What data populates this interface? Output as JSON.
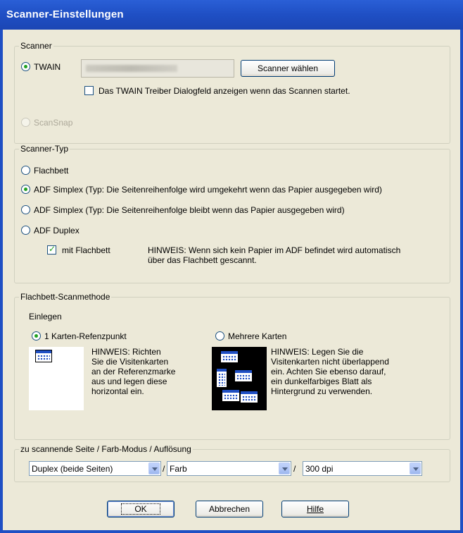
{
  "window": {
    "title": "Scanner-Einstellungen"
  },
  "scanner": {
    "legend": "Scanner",
    "twain_label": "TWAIN",
    "select_button": "Scanner wählen",
    "show_dialog_label": "Das TWAIN Treiber Dialogfeld anzeigen wenn das Scannen startet.",
    "show_dialog_checked": false,
    "scansnap_label": "ScanSnap",
    "selected": "TWAIN"
  },
  "scanner_type": {
    "legend": "Scanner-Typ",
    "options": [
      {
        "label": "Flachbett",
        "selected": false
      },
      {
        "label": "ADF Simplex (Typ: Die Seitenreihenfolge wird umgekehrt wenn das Papier ausgegeben wird)",
        "selected": true
      },
      {
        "label": "ADF Simplex (Typ: Die Seitenreihenfolge bleibt wenn das Papier ausgegeben wird)",
        "selected": false
      },
      {
        "label": "ADF Duplex",
        "selected": false
      }
    ],
    "with_flatbed_label": "mit Flachbett",
    "with_flatbed_checked": true,
    "note_line1": "HINWEIS: Wenn sich kein Papier im ADF befindet wird automatisch",
    "note_line2": "über das Flachbett gescannt."
  },
  "flatbed_method": {
    "legend": "Flachbett-Scanmethode",
    "insert_label": "Einlegen",
    "single_label": "1 Karten-Refenzpunkt",
    "multi_label": "Mehrere Karten",
    "selected": "single",
    "single_note": [
      "HINWEIS: Richten",
      "Sie die Visitenkarten",
      "an der Referenzmarke",
      "aus und legen diese",
      "horizontal ein."
    ],
    "multi_note": [
      "HINWEIS: Legen Sie die",
      "Visitenkarten nicht überlappend",
      "ein. Achten Sie ebenso darauf,",
      "ein dunkelfarbiges Blatt als",
      "Hintergrund zu verwenden."
    ]
  },
  "scan_options": {
    "legend": "zu scannende Seite / Farb-Modus / Auflösung",
    "side": "Duplex (beide Seiten)",
    "color": "Farb",
    "resolution": "300 dpi",
    "separator": "/"
  },
  "buttons": {
    "ok": "OK",
    "cancel": "Abbrechen",
    "help": "Hilfe"
  },
  "icons": [
    "card-icon",
    "cards-multi-icon",
    "dropdown-arrow-icon"
  ]
}
